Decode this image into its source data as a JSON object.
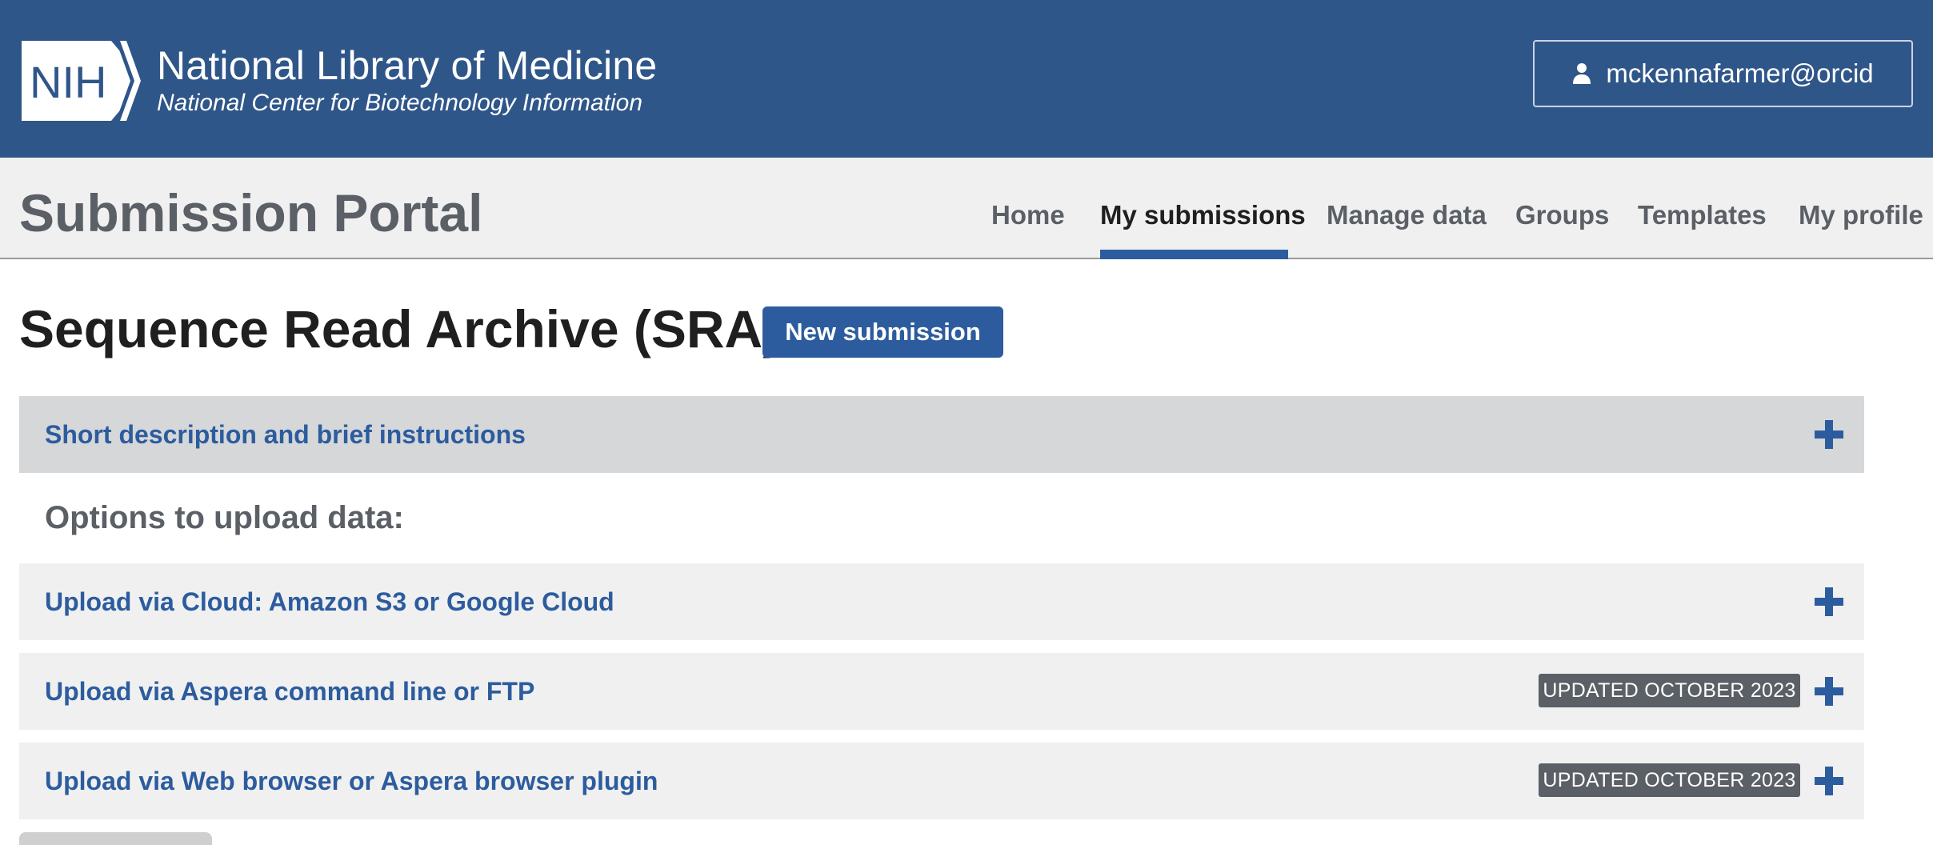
{
  "header": {
    "logo_text": "NIH",
    "org_title": "National Library of Medicine",
    "org_subtitle": "National Center for Biotechnology Information",
    "user_label": "mckennafarmer@orcid",
    "background_color": "#2f5689"
  },
  "portal": {
    "title": "Submission Portal",
    "nav": [
      {
        "label": "Home",
        "active": false
      },
      {
        "label": "My submissions",
        "active": true
      },
      {
        "label": "Manage data",
        "active": false
      },
      {
        "label": "Groups",
        "active": false
      },
      {
        "label": "Templates",
        "active": false
      },
      {
        "label": "My profile",
        "active": false
      }
    ]
  },
  "main": {
    "heading": "Sequence Read Archive (SRA)",
    "new_submission_label": "New submission",
    "instructions_label": "Short description and brief instructions",
    "options_heading": "Options to upload data:",
    "upload_options": [
      {
        "label": "Upload via Cloud: Amazon S3 or Google Cloud",
        "badge": ""
      },
      {
        "label": "Upload via Aspera command line or FTP",
        "badge": "UPDATED OCTOBER 2023"
      },
      {
        "label": "Upload via Web browser or Aspera browser plugin",
        "badge": "UPDATED OCTOBER 2023"
      }
    ]
  },
  "colors": {
    "accent": "#2c5c9e",
    "badge": "#5b5f66",
    "accordion_dark": "#d6d7d9",
    "accordion_light": "#f0f0f0"
  },
  "icons": {
    "user": "user-icon",
    "expand": "plus-icon"
  }
}
